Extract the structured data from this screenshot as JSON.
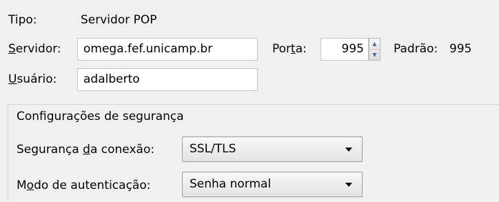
{
  "server": {
    "type_label": "Tipo:",
    "type_value": "Servidor POP",
    "server_label": "Servidor:",
    "server_value": "omega.fef.unicamp.br",
    "port_label": "Porta:",
    "port_value": "995",
    "default_label": "Padrão:",
    "default_value": "995",
    "user_label": "Usuário:",
    "user_value": "adalberto"
  },
  "security": {
    "section_title": "Configurações de segurança",
    "connection_label": "Segurança da conexão:",
    "connection_value": "SSL/TLS",
    "auth_label": "Modo de autenticação:",
    "auth_value": "Senha normal"
  },
  "icons": {
    "spin_up": "spin-up-arrow-icon",
    "spin_down": "spin-down-arrow-icon",
    "dropdown_caret": "chevron-down-icon"
  },
  "colors": {
    "background": "#f0f0f0",
    "field_background": "#ffffff",
    "field_border": "#c6c6c6",
    "spin_arrow": "#4d6d96"
  }
}
